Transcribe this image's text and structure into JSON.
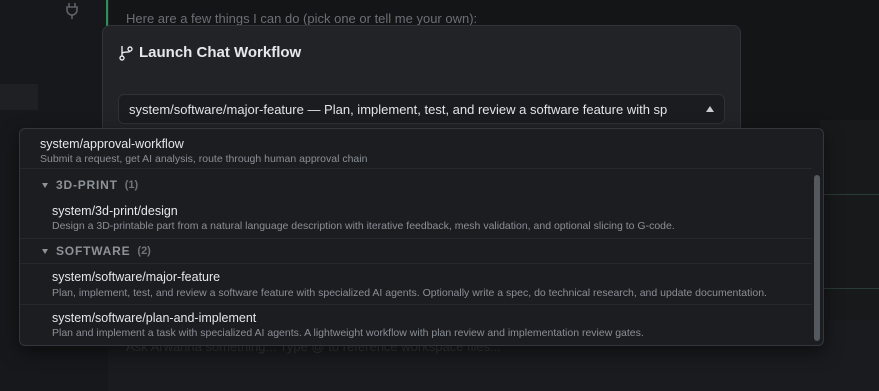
{
  "background": {
    "assistant_text": "Here are a few things I can do (pick one or tell me your own):",
    "input_hint": "Ask Arwanna something... Type @ to reference workspace files..."
  },
  "modal": {
    "title": "Launch Chat Workflow",
    "selected_value": "system/software/major-feature — Plan, implement, test, and review a software feature with sp"
  },
  "dropdown": {
    "items": [
      {
        "title": "system/approval-workflow",
        "description": "Submit a request, get AI analysis, route through human approval chain"
      }
    ],
    "groups": [
      {
        "label": "3D-PRINT",
        "count": "(1)",
        "items": [
          {
            "title": "system/3d-print/design",
            "description": "Design a 3D-printable part from a natural language description with iterative feedback, mesh validation, and optional slicing to G-code."
          }
        ]
      },
      {
        "label": "SOFTWARE",
        "count": "(2)",
        "items": [
          {
            "title": "system/software/major-feature",
            "description": "Plan, implement, test, and review a software feature with specialized AI agents. Optionally write a spec, do technical research, and update documentation."
          },
          {
            "title": "system/software/plan-and-implement",
            "description": "Plan and implement a task with specialized AI agents. A lightweight workflow with plan review and implementation review gates."
          }
        ]
      }
    ]
  }
}
